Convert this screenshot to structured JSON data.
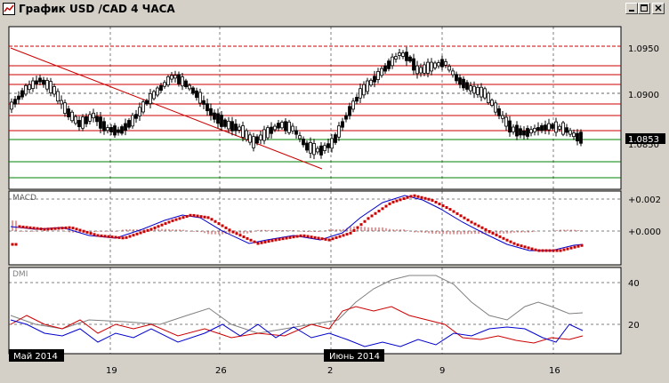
{
  "window": {
    "title": "График USD /CAD  4 ЧАСА",
    "icon": "chart-icon",
    "buttons": [
      "minimize-icon",
      "maximize-icon",
      "close-icon"
    ]
  },
  "price_panel": {
    "y_ticks": [
      "1.0950",
      "1.0900"
    ],
    "current_price": "1.0853",
    "current_price_hidden": "1.0850",
    "colors": {
      "candles": "#000000",
      "red_levels": "#cc0000",
      "green_levels": "#008000",
      "trendline": "#cc0000",
      "background": "#ffffff"
    }
  },
  "macd_panel": {
    "label": "MACD",
    "y_ticks": [
      "+0.002",
      "+0.000"
    ],
    "colors": {
      "histogram": "#cc0000",
      "signal": "#cc0000",
      "macd": "#0000cc"
    }
  },
  "dmi_panel": {
    "label": "DMI",
    "y_ticks": [
      "40",
      "20"
    ],
    "colors": {
      "adx": "#808080",
      "plus_di": "#cc0000",
      "minus_di": "#0000cc"
    }
  },
  "x_axis": {
    "date_labels": [
      "19",
      "26",
      "2",
      "9",
      "16"
    ],
    "month_labels": [
      "Май 2014",
      "Июнь 2014"
    ]
  }
}
